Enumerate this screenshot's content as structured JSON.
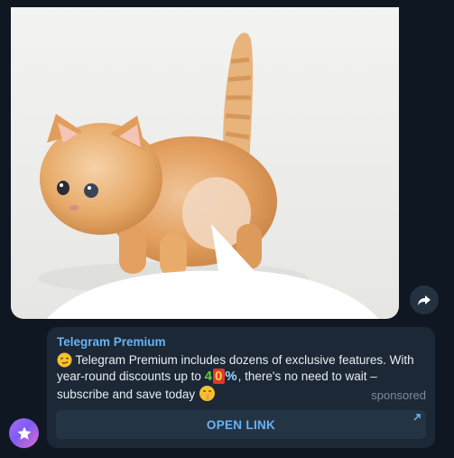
{
  "photo": {
    "alt_icon": "kitten-photo"
  },
  "actions": {
    "share_icon": "share-arrow-icon"
  },
  "ad": {
    "title": "Telegram Premium",
    "text_line_1": " Telegram Premium includes dozens of exclusive features. With",
    "text_line_2_a": "year-round discounts up to ",
    "discount_emoji_text": "40%",
    "text_line_2_b": ", there's no need to wait –",
    "text_line_3": "subscribe and save today ",
    "sponsored_label": "sponsored",
    "button_label": "OPEN LINK",
    "button_icon": "external-link-arrow-icon",
    "leading_emoji_icon": "smirk-emoji-icon",
    "trailing_emoji_icon": "shushing-emoji-icon"
  },
  "avatar": {
    "icon": "premium-star-icon",
    "colors": [
      "#a86bf0",
      "#7f5cf2",
      "#e06bc7"
    ]
  },
  "colors": {
    "background": "#0f1722",
    "bubble": "#1c2836",
    "accent": "#6ab3f3",
    "muted": "#7f8b98"
  }
}
